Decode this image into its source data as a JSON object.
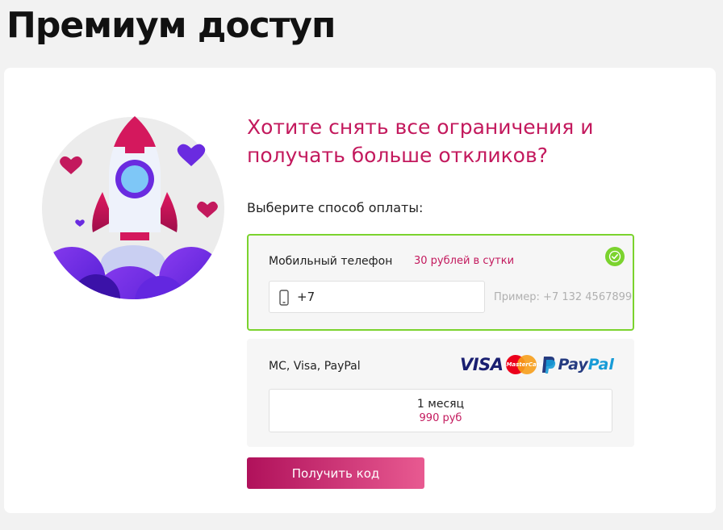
{
  "page": {
    "title": "Премиум доступ"
  },
  "promo": {
    "headline": "Хотите снять все ограничения и получать больше откликов?"
  },
  "payment": {
    "prompt": "Выберите способ оплаты:",
    "phone_option": {
      "title": "Мобильный телефон",
      "price": "30 рублей в сутки",
      "selected": true,
      "input_value": "+7",
      "hint": "Пример: +7 132 4567899"
    },
    "card_option": {
      "title": "MC, Visa, PayPal",
      "logos": {
        "visa": "VISA",
        "mastercard": "MasterCard",
        "paypal_pay": "Pay",
        "paypal_pal": "Pal"
      },
      "plan": {
        "period": "1 месяц",
        "price": "990 руб"
      }
    },
    "submit_label": "Получить код"
  },
  "colors": {
    "accent": "#c3195d",
    "success": "#7bd32e",
    "button_start": "#b0115b",
    "button_end": "#e85a91"
  },
  "icons": [
    "rocket-illustration",
    "heart-icon",
    "check-icon",
    "phone-icon",
    "visa-logo",
    "mastercard-logo",
    "paypal-logo"
  ]
}
